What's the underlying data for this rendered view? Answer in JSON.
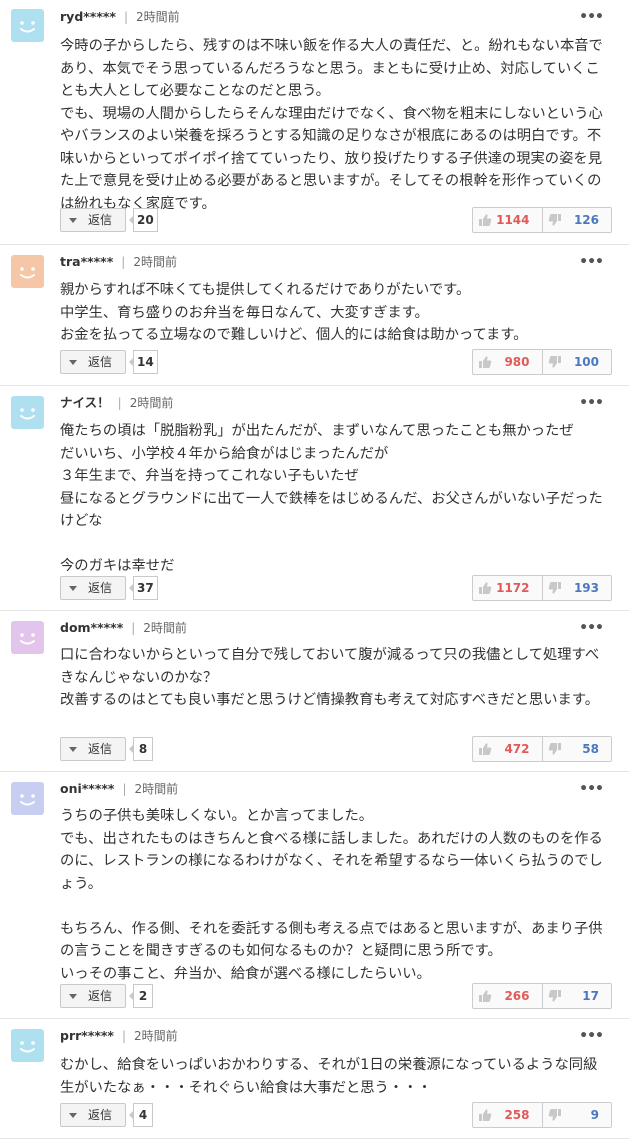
{
  "ui": {
    "reply_label": "返信",
    "more_label": "•••"
  },
  "comments": [
    {
      "user": "ryd*****",
      "time": "2時間前",
      "avatar_color": "#aee0f0",
      "text": "今時の子からしたら、残すのは不味い飯を作る大人の責任だ、と。紛れもない本音であり、本気でそう思っているんだろうなと思う。まともに受け止め、対応していくことも大人として必要なことなのだと思う。\nでも、現場の人間からしたらそんな理由だけでなく、食べ物を粗末にしないという心やバランスのよい栄養を採ろうとする知識の足りなさが根底にあるのは明白です。不味いからといってポイポイ捨てていったり、放り投げたりする子供達の現実の姿を見た上で意見を受け止める必要があると思いますが。そしてその根幹を形作っていくのは紛れもなく家庭です。",
      "replies": "20",
      "likes": "1144",
      "dislikes": "126"
    },
    {
      "user": "tra*****",
      "time": "2時間前",
      "avatar_color": "#f5c7a8",
      "text": "親からすれば不味くても提供してくれるだけでありがたいです。\n中学生、育ち盛りのお弁当を毎日なんて、大変すぎます。\nお金を払ってる立場なので難しいけど、個人的には給食は助かってます。",
      "replies": "14",
      "likes": "980",
      "dislikes": "100"
    },
    {
      "user": "ナイス！",
      "time": "2時間前",
      "avatar_color": "#aee0f0",
      "text": "俺たちの頃は「脱脂粉乳」が出たんだが、まずいなんて思ったことも無かったぜ\nだいいち、小学校４年から給食がはじまったんだが\n３年生まで、弁当を持ってこれない子もいたぜ\n昼になるとグラウンドに出て一人で鉄棒をはじめるんだ、お父さんがいない子だったけどな\n\n今のガキは幸せだ",
      "replies": "37",
      "likes": "1172",
      "dislikes": "193"
    },
    {
      "user": "dom*****",
      "time": "2時間前",
      "avatar_color": "#e3c4ec",
      "text": "口に合わないからといって自分で残しておいて腹が減るって只の我儘として処理すべきなんじゃないのかな？\n改善するのはとても良い事だと思うけど情操教育も考えて対応すべきだと思います。",
      "replies": "8",
      "likes": "472",
      "dislikes": "58"
    },
    {
      "user": "oni*****",
      "time": "2時間前",
      "avatar_color": "#c8cdf2",
      "text": "うちの子供も美味しくない。とか言ってました。\nでも、出されたものはきちんと食べる様に話しました。あれだけの人数のものを作るのに、レストランの様になるわけがなく、それを希望するなら一体いくら払うのでしょう。\n\nもちろん、作る側、それを委託する側も考える点ではあると思いますが、あまり子供の言うことを聞きすぎるのも如何なるものか？と疑問に思う所です。\nいっその事こと、弁当か、給食が選べる様にしたらいい。",
      "replies": "2",
      "likes": "266",
      "dislikes": "17"
    },
    {
      "user": "prr*****",
      "time": "2時間前",
      "avatar_color": "#aee0f0",
      "text": "むかし、給食をいっぱいおかわりする、それが1日の栄養源になっているような同級生がいたなぁ・・・それぐらい給食は大事だと思う・・・",
      "replies": "4",
      "likes": "258",
      "dislikes": "9"
    }
  ]
}
